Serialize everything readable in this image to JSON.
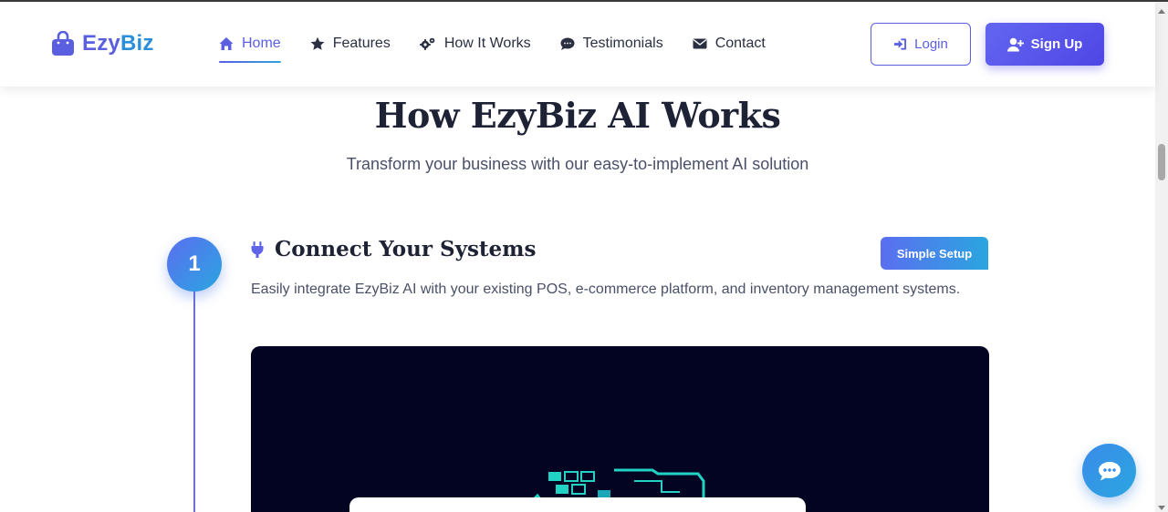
{
  "brand": {
    "name_part1": "Ezy",
    "name_part2": "Biz"
  },
  "nav": {
    "items": [
      {
        "label": "Home",
        "icon": "home-icon",
        "active": true
      },
      {
        "label": "Features",
        "icon": "star-icon",
        "active": false
      },
      {
        "label": "How It Works",
        "icon": "gears-icon",
        "active": false
      },
      {
        "label": "Testimonials",
        "icon": "comment-icon",
        "active": false
      },
      {
        "label": "Contact",
        "icon": "envelope-icon",
        "active": false
      }
    ]
  },
  "auth": {
    "login_label": "Login",
    "signup_label": "Sign Up"
  },
  "section": {
    "title": "How EzyBiz AI Works",
    "subtitle": "Transform your business with our easy-to-implement AI solution"
  },
  "step": {
    "number": "1",
    "icon": "plug-icon",
    "title": "Connect Your Systems",
    "badge": "Simple Setup",
    "description": "Easily integrate EzyBiz AI with your existing POS, e-commerce platform, and inventory management systems."
  },
  "colors": {
    "primary": "#5a5fe0",
    "secondary": "#2aa6e0",
    "dark": "#1e2235",
    "media_bg": "#030322"
  }
}
